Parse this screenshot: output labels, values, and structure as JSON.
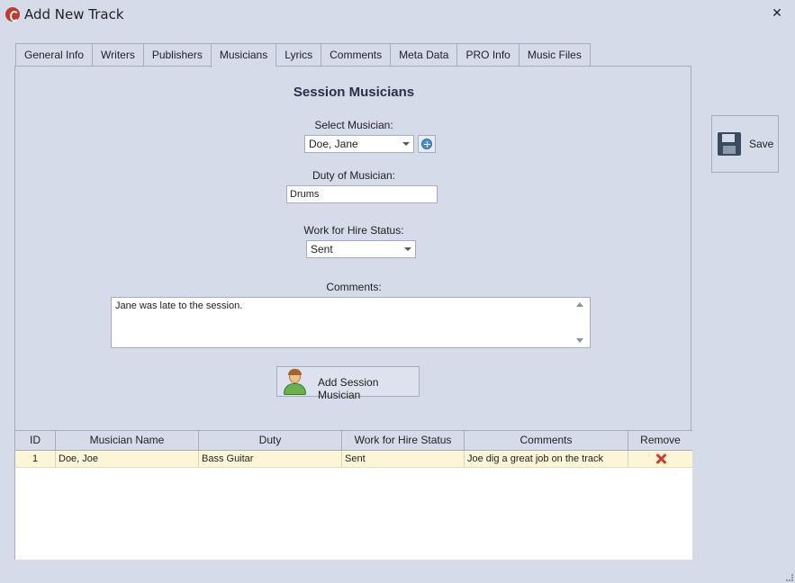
{
  "window": {
    "title": "Add New Track",
    "close_symbol": "✕"
  },
  "tabs": [
    {
      "label": "General Info"
    },
    {
      "label": "Writers"
    },
    {
      "label": "Publishers"
    },
    {
      "label": "Musicians",
      "active": true
    },
    {
      "label": "Lyrics"
    },
    {
      "label": "Comments"
    },
    {
      "label": "Meta Data"
    },
    {
      "label": "PRO Info"
    },
    {
      "label": "Music Files"
    }
  ],
  "form": {
    "heading": "Session Musicians",
    "select_musician_label": "Select Musician:",
    "select_musician_value": "Doe, Jane",
    "duty_label": "Duty of Musician:",
    "duty_value": "Drums",
    "work_for_hire_label": "Work for Hire Status:",
    "work_for_hire_value": "Sent",
    "comments_label": "Comments:",
    "comments_value": "Jane was late to the session.",
    "add_button_label": "Add Session Musician"
  },
  "grid": {
    "columns": [
      "ID",
      "Musician Name",
      "Duty",
      "Work for Hire Status",
      "Comments",
      "Remove"
    ],
    "rows": [
      {
        "id": "1",
        "name": "Doe, Joe",
        "duty": "Bass Guitar",
        "status": "Sent",
        "comments": "Joe dig a great job on the track"
      }
    ]
  },
  "sidebar": {
    "save_label": "Save"
  },
  "icons": {
    "app": "app-logo-icon",
    "close": "close-icon",
    "add": "add-circle-icon",
    "person": "person-icon",
    "remove": "remove-x-icon",
    "save": "floppy-disk-icon"
  },
  "colors": {
    "background": "#d6dbe9",
    "border": "#a3acc0",
    "row_highlight": "#fdf6d6",
    "remove": "#d23a2a"
  }
}
